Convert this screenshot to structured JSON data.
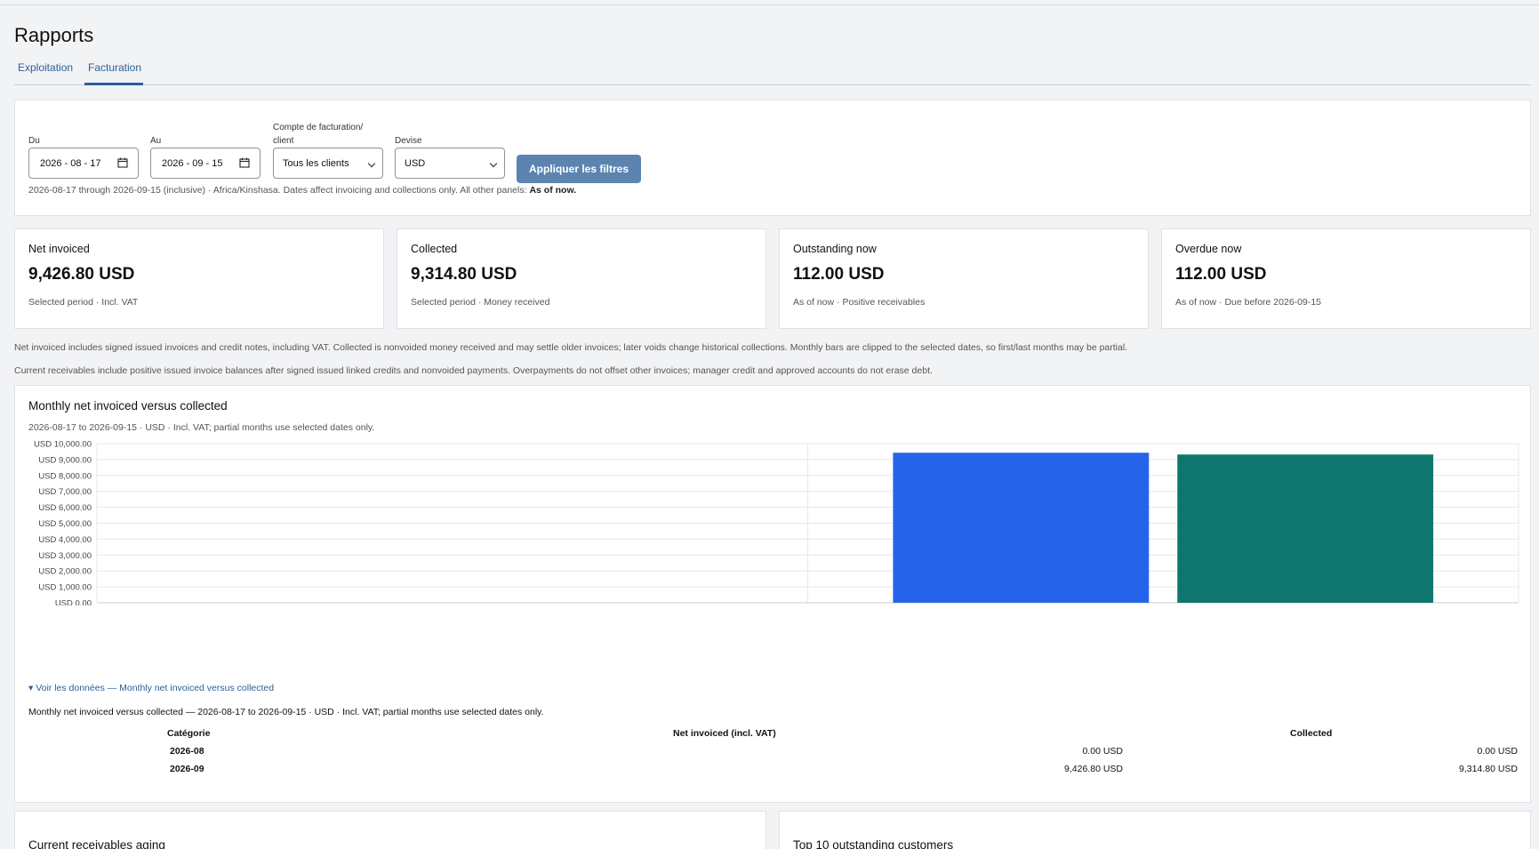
{
  "page": {
    "title": "Rapports"
  },
  "tabs": [
    {
      "label": "Exploitation"
    },
    {
      "label": "Facturation",
      "active": true
    }
  ],
  "filters": {
    "from_label": "Du",
    "from_value": "2026 - 08 - 17",
    "to_label": "Au",
    "to_value": "2026 - 09 - 15",
    "account_label_line1": "Compte de facturation/",
    "account_label_line2": "client",
    "account_value": "Tous les clients",
    "currency_label": "Devise",
    "currency_value": "USD",
    "apply_label": "Appliquer les filtres",
    "note_prefix": "2026-08-17 through 2026-09-15 (inclusive) · Africa/Kinshasa. Dates affect invoicing and collections only. All other panels:",
    "note_bold": "As of now."
  },
  "kpis": [
    {
      "label": "Net invoiced",
      "value": "9,426.80 USD",
      "sub": "Selected period · Incl. VAT"
    },
    {
      "label": "Collected",
      "value": "9,314.80 USD",
      "sub": "Selected period · Money received"
    },
    {
      "label": "Outstanding now",
      "value": "112.00 USD",
      "sub": "As of now · Positive receivables"
    },
    {
      "label": "Overdue now",
      "value": "112.00 USD",
      "sub": "As of now · Due before 2026-09-15"
    }
  ],
  "notes": {
    "line1": "Net invoiced includes signed issued invoices and credit notes, including VAT. Collected is nonvoided money received and may settle older invoices; later voids change historical collections. Monthly bars are clipped to the selected dates, so first/last months may be partial.",
    "line2": "Current receivables include positive issued invoice balances after signed issued linked credits and nonvoided payments. Overpayments do not offset other invoices; manager credit and approved accounts do not erase debt."
  },
  "chart_section": {
    "title": "Monthly net invoiced versus collected",
    "subtitle": "2026-08-17 to 2026-09-15 · USD · Incl. VAT; partial months use selected dates only.",
    "details_label": "▾ Voir les données — Monthly net invoiced versus collected",
    "table_caption": "Monthly net invoiced versus collected — 2026-08-17 to 2026-09-15 · USD · Incl. VAT; partial months use selected dates only.",
    "table_headers": [
      "Catégorie",
      "Net invoiced (incl. VAT)",
      "Collected"
    ],
    "table_rows": [
      [
        "2026-08",
        "0.00 USD",
        "0.00 USD"
      ],
      [
        "2026-09",
        "9,426.80 USD",
        "9,314.80 USD"
      ]
    ]
  },
  "chart_data": {
    "type": "bar",
    "categories": [
      "2026-08",
      "2026-09"
    ],
    "series": [
      {
        "name": "Net invoiced (incl. VAT)",
        "values": [
          0,
          9426.8
        ],
        "color": "#2563eb"
      },
      {
        "name": "Collected",
        "values": [
          0,
          9314.8
        ],
        "color": "#0f766e"
      }
    ],
    "ylim": [
      0,
      10000
    ],
    "y_ticks": [
      0,
      1000,
      2000,
      3000,
      4000,
      5000,
      6000,
      7000,
      8000,
      9000,
      10000
    ],
    "y_tick_labels": [
      "USD 0.00",
      "USD 1,000.00",
      "USD 2,000.00",
      "USD 3,000.00",
      "USD 4,000.00",
      "USD 5,000.00",
      "USD 6,000.00",
      "USD 7,000.00",
      "USD 8,000.00",
      "USD 9,000.00",
      "USD 10,000.00"
    ],
    "grid": true,
    "legend": "bottom"
  },
  "bottom_cards": [
    {
      "title": "Current receivables aging"
    },
    {
      "title": "Top 10 outstanding customers"
    }
  ]
}
